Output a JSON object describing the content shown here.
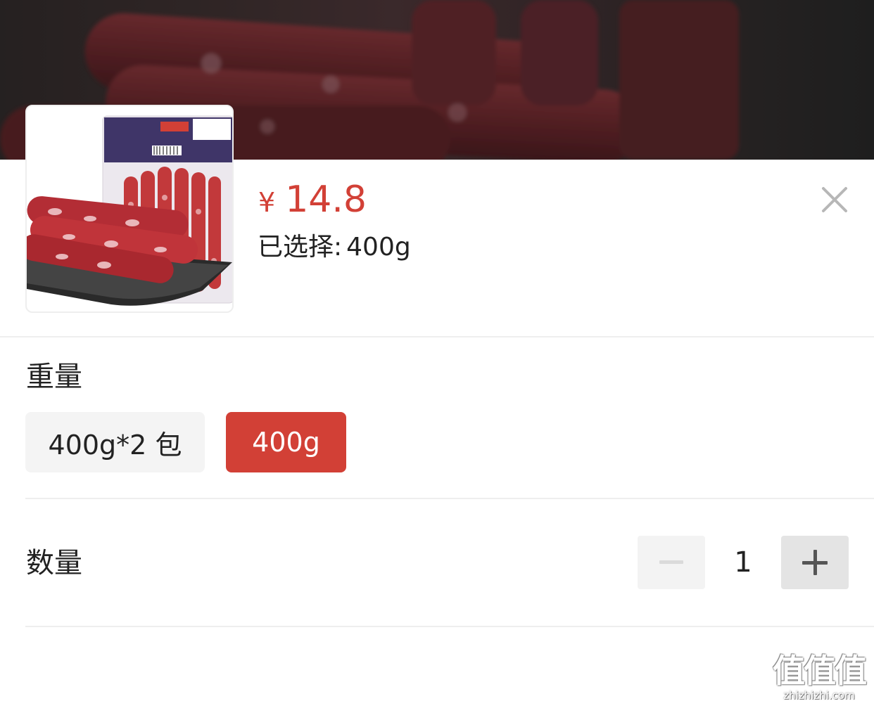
{
  "product": {
    "image_icon": "sausage-product-photo",
    "price_currency": "¥",
    "price_value": "14.8",
    "selected_label": "已选择",
    "selected_colon": ":",
    "selected_value": "400g"
  },
  "close_icon": "close-icon",
  "weight_section": {
    "title": "重量",
    "options": [
      {
        "label": "400g*2 包",
        "selected": false
      },
      {
        "label": "400g",
        "selected": true
      }
    ]
  },
  "quantity_section": {
    "title": "数量",
    "value": "1",
    "minus_icon": "minus-icon",
    "plus_icon": "plus-icon",
    "minus_disabled": true
  },
  "watermark": {
    "glyphs": "值值值",
    "url": "zhizhizhi.com"
  },
  "colors": {
    "accent": "#d24036",
    "option_bg": "#f4f4f4",
    "text": "#222222",
    "divider": "#eeeeee"
  }
}
